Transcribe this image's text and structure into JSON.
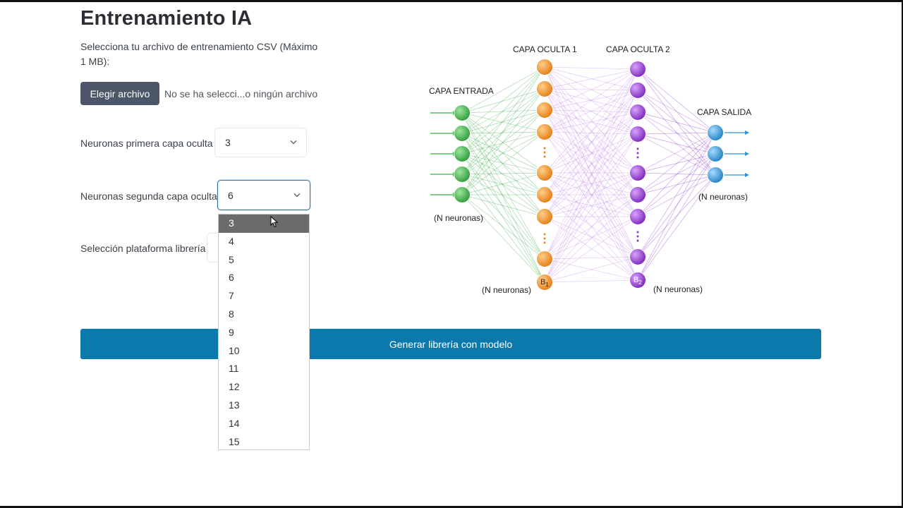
{
  "page": {
    "title": "Entrenamiento IA",
    "file_label": "Selecciona tu archivo de entrenamiento CSV (Máximo 1 MB):",
    "file_button": "Elegir archivo",
    "file_status": "No se ha selecci...o ningún archivo"
  },
  "form": {
    "layer1": {
      "label": "Neuronas primera capa oculta",
      "value": "3"
    },
    "layer2": {
      "label": "Neuronas segunda capa oculta",
      "value": "6"
    },
    "platform": {
      "label": "Selección plataforma librería"
    }
  },
  "dropdown": {
    "options": [
      "3",
      "4",
      "5",
      "6",
      "7",
      "8",
      "9",
      "10",
      "11",
      "12",
      "13",
      "14",
      "15"
    ],
    "highlighted": "3"
  },
  "generate_button": "Generar librería con modelo",
  "diagram": {
    "input_label": "CAPA ENTRADA",
    "hidden1_label": "CAPA OCULTA 1",
    "hidden2_label": "CAPA OCULTA 2",
    "output_label": "CAPA SALIDA",
    "n_input": "(N neuronas)",
    "n_hidden1": "(N neuronas)",
    "n_hidden2": "(N neuronas)",
    "n_output": "(N neuronas)",
    "bias1": "B",
    "bias1_sub": "1",
    "bias2": "B",
    "bias2_sub": "2",
    "colors": {
      "input": "#3fae49",
      "hidden1": "#ee8a1d",
      "hidden2": "#8b33c7",
      "output": "#2f93d3"
    }
  },
  "colors": {
    "primary_button": "#0b79ac",
    "file_button": "#4b5668",
    "highlight_option": "#6b6b6b"
  }
}
